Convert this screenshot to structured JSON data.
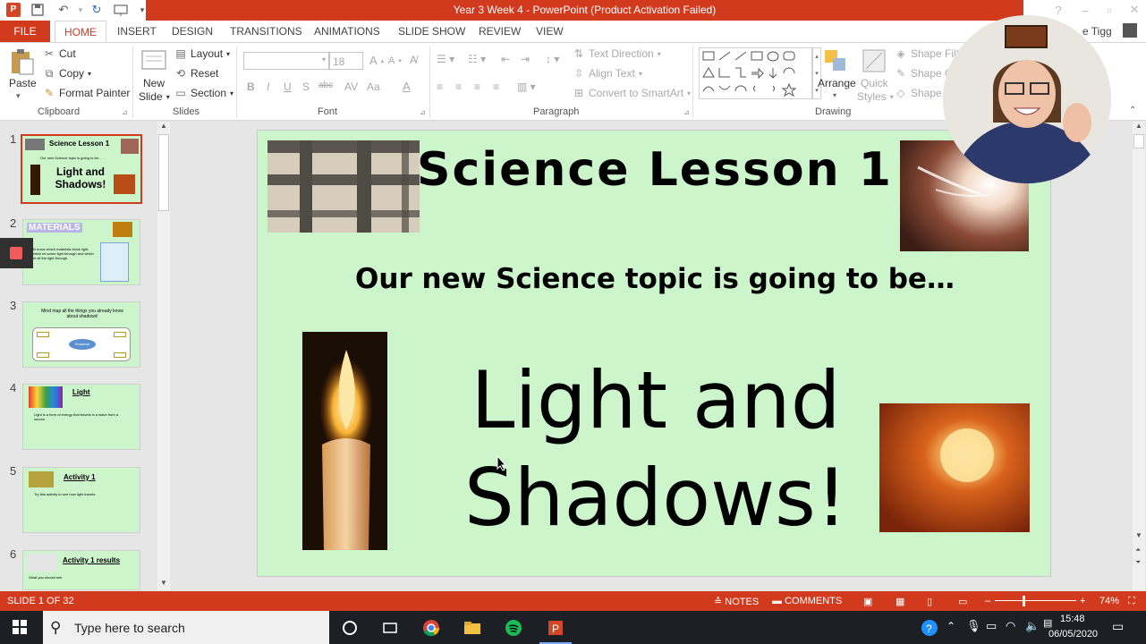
{
  "titlebar": {
    "title": "Year 3 Week 4 -  PowerPoint (Product Activation Failed)",
    "user": "e Tigg"
  },
  "tabs": [
    "FILE",
    "HOME",
    "INSERT",
    "DESIGN",
    "TRANSITIONS",
    "ANIMATIONS",
    "SLIDE SHOW",
    "REVIEW",
    "VIEW"
  ],
  "ribbon": {
    "clipboard": {
      "paste": "Paste",
      "cut": "Cut",
      "copy": "Copy",
      "format_painter": "Format Painter",
      "label": "Clipboard"
    },
    "slides": {
      "new_slide_1": "New",
      "new_slide_2": "Slide",
      "layout": "Layout",
      "reset": "Reset",
      "section": "Section",
      "label": "Slides"
    },
    "font": {
      "size": "18",
      "label": "Font",
      "bold": "B",
      "italic": "I",
      "underline": "U",
      "shadow": "S",
      "strike": "abc",
      "case": "Aa"
    },
    "paragraph": {
      "text_direction": "Text Direction",
      "align_text": "Align Text",
      "convert_smartart": "Convert to SmartArt",
      "label": "Paragraph"
    },
    "drawing": {
      "arrange": "Arrange",
      "quick_styles_1": "Quick",
      "quick_styles_2": "Styles",
      "shape_fill": "Shape Fill",
      "shape_outline": "Shape O",
      "shape_effects": "Shape E",
      "label": "Drawing"
    }
  },
  "thumbnails": [
    {
      "num": "1",
      "title": "Science Lesson 1",
      "sub": "Our new Science topic is going to be...",
      "big": "Light and Shadows!"
    },
    {
      "num": "2",
      "title": "MATERIALS",
      "sub": "To know which materials block light, which let some light through and which let all the light through."
    },
    {
      "num": "3",
      "title": "Mind map all the things you already know about shadows!",
      "center": "Shadows"
    },
    {
      "num": "4",
      "title": "Light",
      "sub": "Light is a form of energy that travels in a wave from a source."
    },
    {
      "num": "5",
      "title": "Activity 1",
      "sub": "Try this activity to see how light travels:"
    },
    {
      "num": "6",
      "title": "Activity 1 results",
      "sub": "What you should see"
    }
  ],
  "slide": {
    "title": "Science Lesson 1",
    "subtitle": "Our new Science topic is going to be…",
    "big_line1": "Light and",
    "big_line2": "Shadows!"
  },
  "status": {
    "slide_count": "SLIDE 1 OF 32",
    "notes": "NOTES",
    "comments": "COMMENTS",
    "zoom": "74%",
    "zoom_level": 0.74
  },
  "taskbar": {
    "search_placeholder": "Type here to search",
    "time": "15:48",
    "date": "06/05/2020"
  },
  "colors": {
    "accent": "#d23a1e",
    "slide_bg": "#ccf5cc",
    "taskbar": "#1c1f24"
  }
}
